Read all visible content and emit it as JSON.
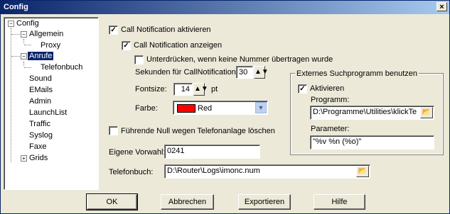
{
  "window": {
    "title": "Config",
    "close_glyph": "×"
  },
  "tree": {
    "items": [
      {
        "label": "Config",
        "expander": "−"
      },
      {
        "label": "Allgemein",
        "expander": "−"
      },
      {
        "label": "Proxy"
      },
      {
        "label": "Anrufe",
        "expander": "−",
        "selected": true
      },
      {
        "label": "Telefonbuch"
      },
      {
        "label": "Sound"
      },
      {
        "label": "EMails"
      },
      {
        "label": "Admin"
      },
      {
        "label": "LaunchList"
      },
      {
        "label": "Traffic"
      },
      {
        "label": "Syslog"
      },
      {
        "label": "Faxe"
      },
      {
        "label": "Grids",
        "expander": "+"
      }
    ]
  },
  "callnotification": {
    "activate_label": "Call Notification aktivieren",
    "activate_checked": true,
    "show_label": "Call Notification anzeigen",
    "show_checked": true,
    "suppress_label": "Unterdrücken, wenn keine Nummer übertragen wurde",
    "suppress_checked": false,
    "seconds_label": "Sekunden für CallNotification:",
    "seconds_value": "30",
    "fontsize_label": "Fontsize:",
    "fontsize_value": "14",
    "fontsize_unit": "pt",
    "color_label": "Farbe:",
    "color_value": "Red",
    "color_hex": "#ff0000"
  },
  "external_search": {
    "group_title": "Externes Suchprogramm benutzen",
    "activate_label": "Aktivieren",
    "activate_checked": true,
    "program_label": "Programm:",
    "program_value": "D:\\Programme\\Utilities\\klickTe",
    "params_label": "Parameter:",
    "params_value": "\"%v %n (%o)\""
  },
  "leading_zero": {
    "label": "Führende Null wegen Telefonanlage löschen",
    "checked": false
  },
  "own_prefix": {
    "label": "Eigene Vorwahl:",
    "value": "0241"
  },
  "phonebook": {
    "label": "Telefonbuch:",
    "value": "D:\\Router\\Logs\\imonc.num"
  },
  "buttons": {
    "ok": "OK",
    "cancel": "Abbrechen",
    "export": "Exportieren",
    "help": "Hilfe"
  },
  "icons": {
    "check": "✓",
    "spin": "▲▼",
    "folder": "📂",
    "dropdown": "▼"
  }
}
